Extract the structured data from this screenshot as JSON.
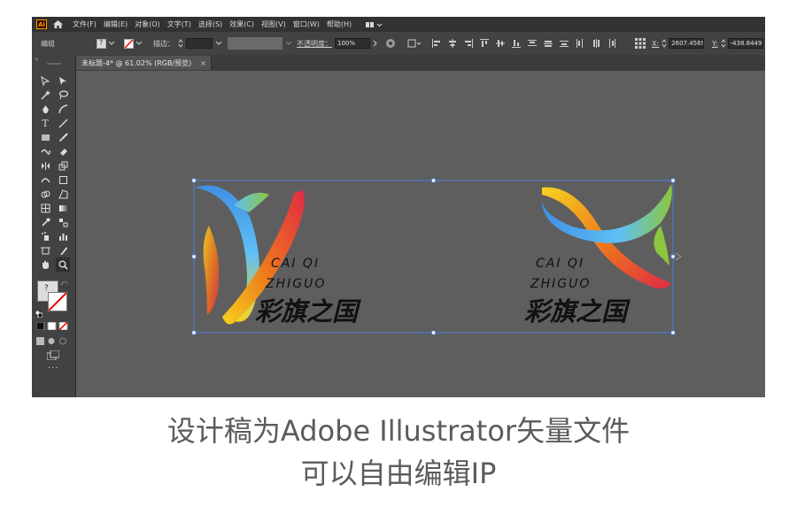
{
  "menubar": {
    "app_badge": "Ai",
    "items": [
      "文件(F)",
      "编辑(E)",
      "对象(O)",
      "文字(T)",
      "选择(S)",
      "效果(C)",
      "视图(V)",
      "窗口(W)",
      "帮助(H)"
    ]
  },
  "controlbar": {
    "group_label": "编组",
    "stroke_label": "描边：",
    "opacity_label": "不透明度：",
    "opacity_value": "100%",
    "x_label": "X:",
    "x_value": "2607.4569",
    "y_label": "Y:",
    "y_value": "-438.8449"
  },
  "document_tab": {
    "title": "未标题-4* @ 61.02% (RGB/预览)",
    "close": "×"
  },
  "artwork": {
    "logo_pinyin_line1": "CAI QI",
    "logo_pinyin_line2": "ZHIGUO",
    "logo_chinese": "彩旗之国",
    "ribbon_colors": [
      "#3f8fe3",
      "#5fc0f5",
      "#f7d21e",
      "#ee7b1c",
      "#e02a45",
      "#8cc63e"
    ]
  },
  "caption": {
    "line1": "设计稿为Adobe Illustrator矢量文件",
    "line2": "可以自由编辑IP"
  }
}
